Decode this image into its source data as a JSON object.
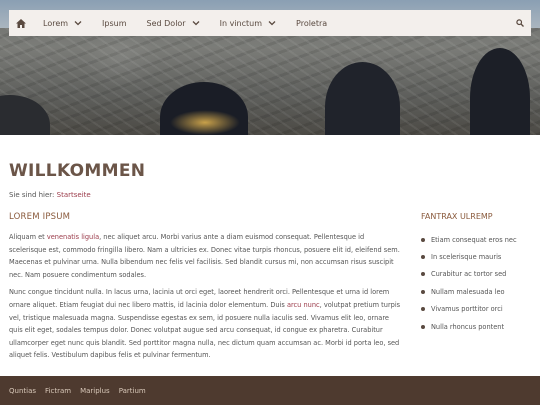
{
  "nav": {
    "items": [
      {
        "label": "Lorem",
        "has_dropdown": true
      },
      {
        "label": "Ipsum",
        "has_dropdown": false
      },
      {
        "label": "Sed Dolor",
        "has_dropdown": true
      },
      {
        "label": "In vinctum",
        "has_dropdown": true
      },
      {
        "label": "Proletra",
        "has_dropdown": false
      }
    ],
    "home_icon": "home-icon",
    "search_icon": "search-icon"
  },
  "page": {
    "title": "WILLKOMMEN",
    "breadcrumb_prefix": "Sie sind hier: ",
    "breadcrumb_link": "Startseite"
  },
  "main": {
    "heading": "LOREM IPSUM",
    "p1_a": "Aliquam et ",
    "p1_link": "venenatis ligula",
    "p1_b": ", nec aliquet arcu. Morbi varius ante a diam euismod consequat. Pellentesque id scelerisque est, commodo fringilla libero. Nam a ultricies ex. Donec vitae turpis rhoncus, posuere elit id, eleifend sem. Maecenas et pulvinar urna. Nulla bibendum nec felis vel facilisis. Sed blandit cursus mi, non accumsan risus suscipit nec. Nam posuere condimentum sodales.",
    "p2_a": "Nunc congue tincidunt nulla. In lacus urna, lacinia ut orci eget, laoreet hendrerit orci. Pellentesque et urna id lorem ornare aliquet. Etiam feugiat dui nec libero mattis, id lacinia dolor elementum. Duis ",
    "p2_link": "arcu nunc",
    "p2_b": ", volutpat pretium turpis vel, tristique malesuada magna. Suspendisse egestas ex sem, id posuere nulla iaculis sed. Vivamus elit leo, ornare quis elit eget, sodales tempus dolor. Donec volutpat augue sed arcu consequat, id congue ex pharetra. Curabitur ullamcorper eget nunc quis blandit. Sed porttitor magna nulla, nec dictum quam accumsan ac. Morbi id porta leo, sed aliquet felis. Vestibulum dapibus felis et pulvinar fermentum."
  },
  "sidebar": {
    "heading": "FANTRAX ULREMP",
    "items": [
      "Etiam consequat eros nec",
      "In scelerisque mauris",
      "Curabitur ac tortor sed",
      "Nullam malesuada leo",
      "Vivamus porttitor orci",
      "Nulla rhoncus pontent"
    ]
  },
  "footer": {
    "links": [
      "Quntias",
      "Fictram",
      "Mariplus",
      "Partium"
    ]
  },
  "colors": {
    "accent": "#9b3b4a",
    "heading": "#8a5a3c",
    "footer_bg": "#4e3a2f",
    "nav_bg": "#f3efec"
  }
}
